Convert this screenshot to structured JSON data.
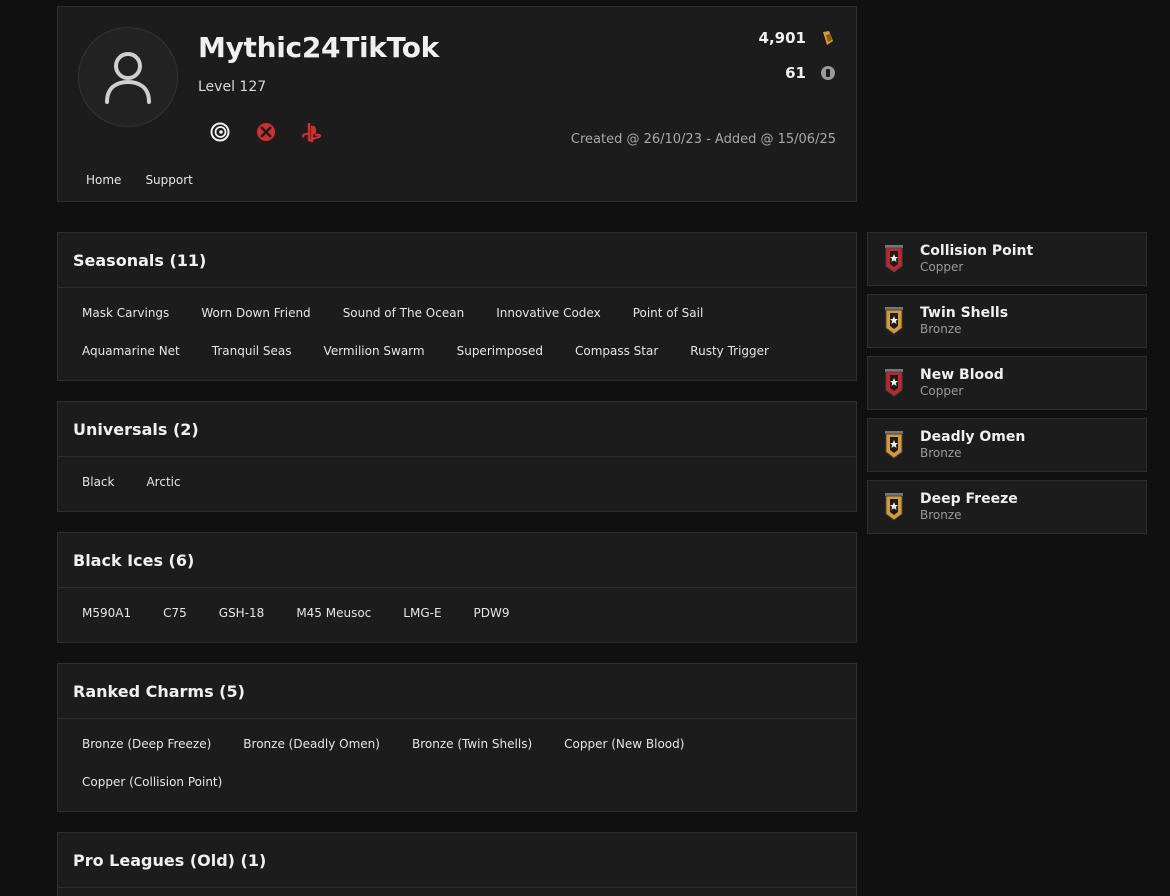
{
  "profile": {
    "username": "Mythic24TikTok",
    "level": "Level 127",
    "credits": "4,901",
    "renown": "61",
    "created": "Created @ 26/10/23 - Added @ 15/06/25",
    "platforms": [
      "ubisoft-icon",
      "xbox-icon",
      "playstation-icon"
    ],
    "nav": [
      "Home",
      "Support"
    ]
  },
  "sections": {
    "seasonals": {
      "title": "Seasonals (11)",
      "items": [
        "Mask Carvings",
        "Worn Down Friend",
        "Sound of The Ocean",
        "Innovative Codex",
        "Point of Sail",
        "Aquamarine Net",
        "Tranquil Seas",
        "Vermilion Swarm",
        "Superimposed",
        "Compass Star",
        "Rusty Trigger"
      ]
    },
    "universals": {
      "title": "Universals (2)",
      "items": [
        "Black",
        "Arctic"
      ]
    },
    "blackices": {
      "title": "Black Ices (6)",
      "items": [
        "M590A1",
        "C75",
        "GSH-18",
        "M45 Meusoc",
        "LMG-E",
        "PDW9"
      ]
    },
    "rankedcharms": {
      "title": "Ranked Charms (5)",
      "items": [
        "Bronze (Deep Freeze)",
        "Bronze (Deadly Omen)",
        "Bronze (Twin Shells)",
        "Copper (New Blood)",
        "Copper (Collision Point)"
      ]
    },
    "proleagues": {
      "title": "Pro Leagues (Old) (1)"
    }
  },
  "charms": [
    {
      "name": "Collision Point",
      "rank": "Copper"
    },
    {
      "name": "Twin Shells",
      "rank": "Bronze"
    },
    {
      "name": "New Blood",
      "rank": "Copper"
    },
    {
      "name": "Deadly Omen",
      "rank": "Bronze"
    },
    {
      "name": "Deep Freeze",
      "rank": "Bronze"
    }
  ],
  "colors": {
    "background": "#101010",
    "card": "#1c1c1c",
    "copper": "#c0272d",
    "bronze": "#d79a3a",
    "xbox": "#d32f2f",
    "playstation": "#d32f2f"
  }
}
